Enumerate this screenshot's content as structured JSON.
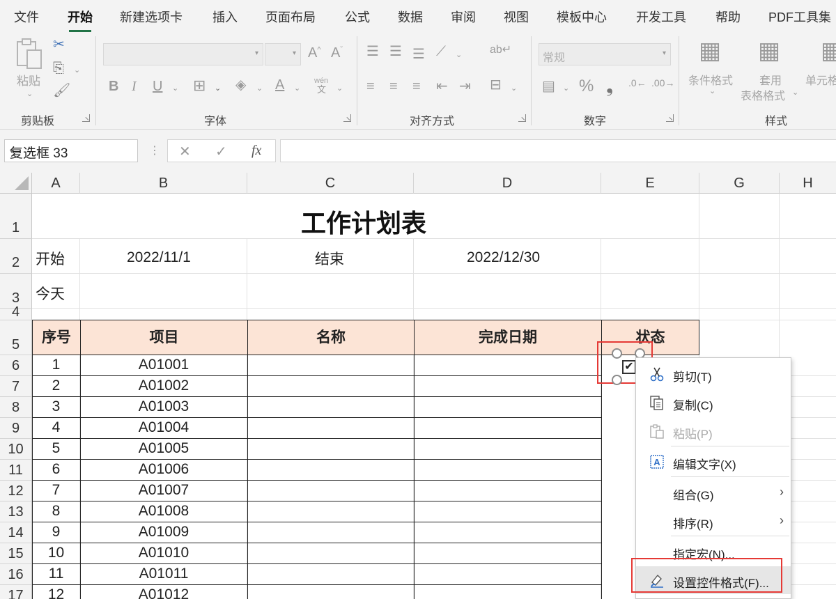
{
  "ribbon_tabs": [
    "文件",
    "开始",
    "新建选项卡",
    "插入",
    "页面布局",
    "公式",
    "数据",
    "审阅",
    "视图",
    "模板中心",
    "开发工具",
    "帮助",
    "PDF工具集"
  ],
  "active_tab": "开始",
  "ribbon": {
    "clipboard": {
      "paste_label": "粘贴",
      "group_label": "剪贴板"
    },
    "font": {
      "group_label": "字体",
      "phonetic": "wén"
    },
    "alignment": {
      "group_label": "对齐方式"
    },
    "number": {
      "format_value": "常规",
      "group_label": "数字"
    },
    "styles": {
      "conditional_format": "条件格式",
      "table_format_line1": "套用",
      "table_format_line2": "表格格式",
      "cell_styles": "单元格",
      "group_label": "样式"
    }
  },
  "formula_bar": {
    "name_box": "复选框 33",
    "fx": "fx",
    "formula": ""
  },
  "columns": [
    "A",
    "B",
    "C",
    "D",
    "E",
    "G",
    "H"
  ],
  "rows": [
    "1",
    "2",
    "3",
    "4",
    "5",
    "6",
    "7",
    "8",
    "9",
    "10",
    "11",
    "12",
    "13",
    "14",
    "15",
    "16",
    "17"
  ],
  "sheet": {
    "title": "工作计划表",
    "start_label": "开始",
    "start_date": "2022/11/1",
    "end_label": "结束",
    "end_date": "2022/12/30",
    "today_label": "今天",
    "headers": [
      "序号",
      "项目",
      "名称",
      "完成日期",
      "状态"
    ],
    "items": [
      {
        "no": "1",
        "code": "A01001"
      },
      {
        "no": "2",
        "code": "A01002"
      },
      {
        "no": "3",
        "code": "A01003"
      },
      {
        "no": "4",
        "code": "A01004"
      },
      {
        "no": "5",
        "code": "A01005"
      },
      {
        "no": "6",
        "code": "A01006"
      },
      {
        "no": "7",
        "code": "A01007"
      },
      {
        "no": "8",
        "code": "A01008"
      },
      {
        "no": "9",
        "code": "A01009"
      },
      {
        "no": "10",
        "code": "A01010"
      },
      {
        "no": "11",
        "code": "A01011"
      },
      {
        "no": "12",
        "code": "A01012"
      }
    ]
  },
  "checkbox": {
    "checked": true,
    "mark": "✔"
  },
  "context_menu": [
    {
      "label": "剪切(T)",
      "icon": "scissors-icon",
      "disabled": false,
      "submenu": false
    },
    {
      "label": "复制(C)",
      "icon": "copy-icon",
      "disabled": false,
      "submenu": false
    },
    {
      "label": "粘贴(P)",
      "icon": "paste-icon",
      "disabled": true,
      "submenu": false
    },
    {
      "label": "编辑文字(X)",
      "icon": "edit-text-icon",
      "disabled": false,
      "submenu": false
    },
    {
      "label": "组合(G)",
      "icon": "",
      "disabled": false,
      "submenu": true
    },
    {
      "label": "排序(R)",
      "icon": "",
      "disabled": false,
      "submenu": true
    },
    {
      "label": "指定宏(N)...",
      "icon": "",
      "disabled": false,
      "submenu": false
    },
    {
      "label": "设置控件格式(F)...",
      "icon": "format-control-icon",
      "disabled": false,
      "submenu": false,
      "highlighted": true
    }
  ],
  "colors": {
    "accent": "#217346",
    "header_fill": "#fce4d6",
    "highlight_box": "#e53935"
  }
}
